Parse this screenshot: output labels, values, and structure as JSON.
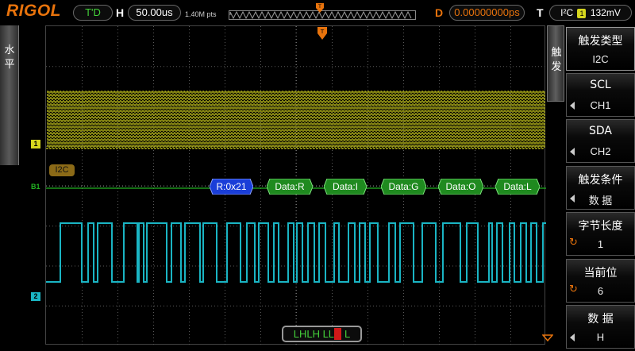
{
  "brand": "RIGOL",
  "run_status": "T'D",
  "horizontal": {
    "label": "H",
    "timebase": "50.00us",
    "sample_points": "1.40M pts"
  },
  "delay": {
    "label": "D",
    "value": "0.00000000ps"
  },
  "trigger": {
    "label": "T",
    "type_text": "I²C",
    "source_badge": "1",
    "level": "132mV"
  },
  "left_tab": {
    "chars": [
      "水",
      "平"
    ]
  },
  "right_tab": {
    "chars": [
      "触",
      "发"
    ]
  },
  "menu": [
    {
      "title": "触发类型",
      "value": "I2C"
    },
    {
      "title": "SCL",
      "value": "CH1"
    },
    {
      "title": "SDA",
      "value": "CH2"
    },
    {
      "title": "触发条件",
      "value": "数 据"
    },
    {
      "title": "字节长度",
      "value": "1"
    },
    {
      "title": "当前位",
      "value": "6"
    },
    {
      "title": "数 据",
      "value": "H"
    }
  ],
  "decode": {
    "bus_label": "I2C",
    "frames": [
      {
        "text": "R:0x21",
        "kind": "address"
      },
      {
        "text": "Data:R",
        "kind": "data"
      },
      {
        "text": "Data:I",
        "kind": "data"
      },
      {
        "text": "Data:G",
        "kind": "data"
      },
      {
        "text": "Data:O",
        "kind": "data"
      },
      {
        "text": "Data:L",
        "kind": "data"
      }
    ]
  },
  "channel_markers": {
    "ch1": "1",
    "bus": "B1",
    "ch2": "2"
  },
  "trigger_pattern": {
    "prefix": "LHLH LL",
    "current": "H",
    "suffix": " L"
  },
  "colors": {
    "ch1": "#d6d61e",
    "ch2": "#1ab5c4",
    "bus": "#22b222",
    "address_frame": "#1a3ed8",
    "data_frame": "#1f8a1f",
    "accent": "#e8730c",
    "grid": "#5a5a5a"
  }
}
